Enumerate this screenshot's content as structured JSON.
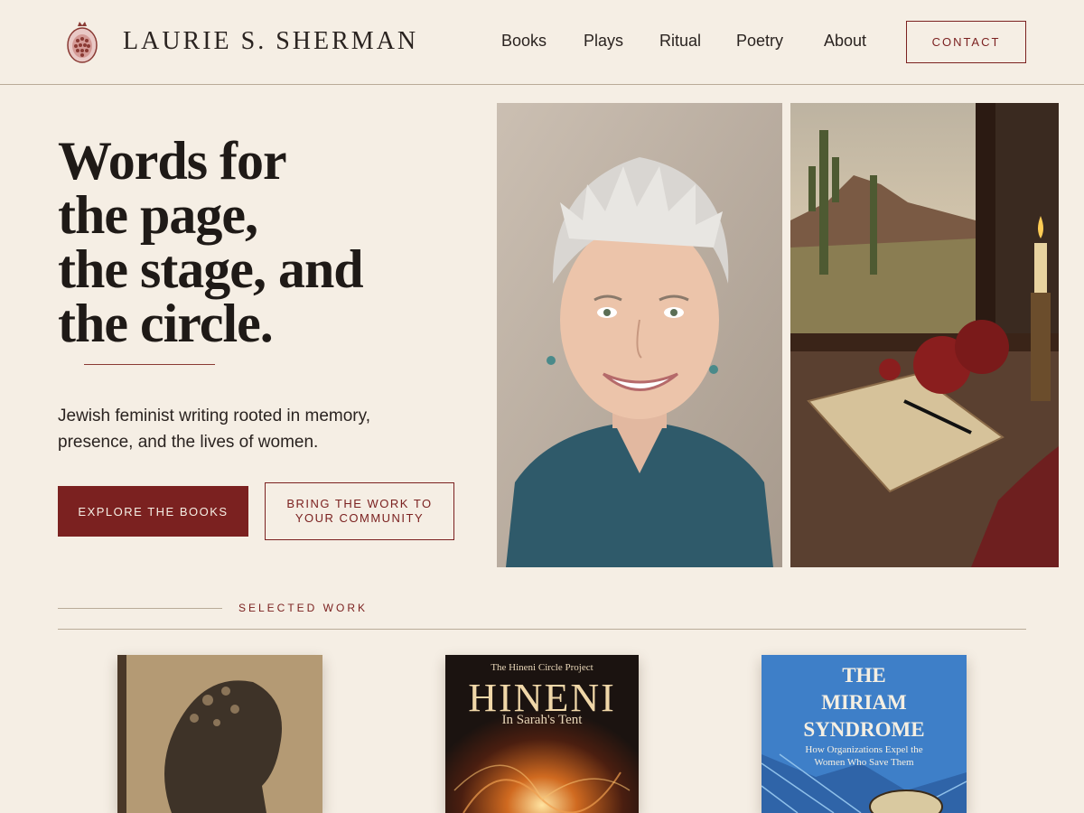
{
  "header": {
    "brand": "LAURIE S. SHERMAN",
    "nav": [
      "Books",
      "Plays",
      "Ritual",
      "Poetry",
      "About"
    ],
    "contact_label": "CONTACT"
  },
  "hero": {
    "title_lines": [
      "Words for",
      "the page,",
      "the stage, and",
      "the circle."
    ],
    "subtitle": "Jewish feminist writing rooted in memory, presence, and the lives of women.",
    "primary_cta": "EXPLORE THE BOOKS",
    "secondary_cta": "BRING THE WORK TO YOUR COMMUNITY"
  },
  "selected_work": {
    "label": "SELECTED WORK",
    "books": [
      {
        "lines": []
      },
      {
        "series": "The Hineni Circle Project",
        "title": "HINENI",
        "subtitle": "In Sarah's Tent"
      },
      {
        "title_lines": [
          "THE",
          "MIRIAM",
          "SYNDROME"
        ],
        "subtitle_lines": [
          "How Organizations Expel the",
          "Women Who Save Them"
        ]
      }
    ]
  },
  "colors": {
    "background": "#f5eee4",
    "accent": "#7b2120",
    "text": "#2a2320",
    "rule": "#b9ab98"
  },
  "icons": {
    "logo": "pomegranate-icon"
  }
}
